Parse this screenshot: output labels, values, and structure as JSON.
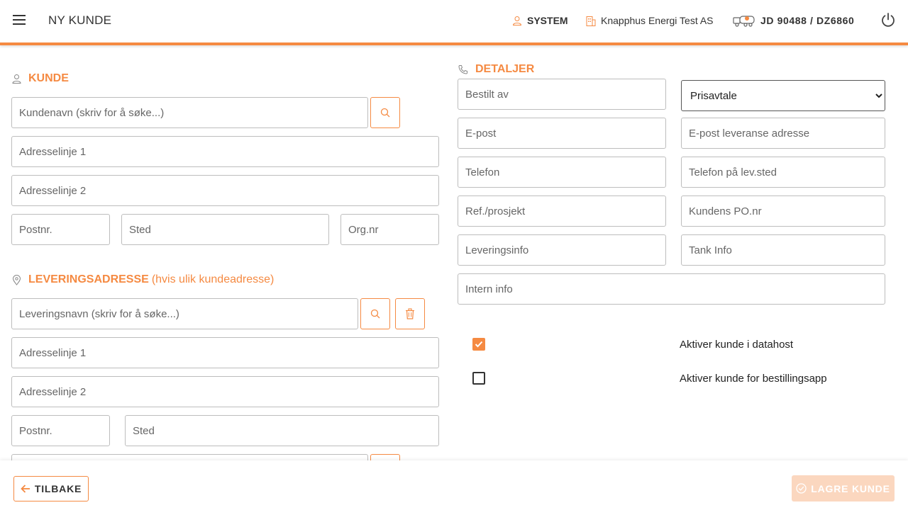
{
  "header": {
    "title": "NY KUNDE",
    "user": "SYSTEM",
    "company": "Knapphus Energi Test AS",
    "vehicle": "JD 90488 / DZ6860",
    "icons": {
      "menu": "hamburger-menu-icon",
      "user": "user-icon",
      "company": "building-icon",
      "vehicle": "truck-icon",
      "power": "power-icon"
    }
  },
  "kunde": {
    "heading": "KUNDE",
    "name_placeholder": "Kundenavn (skriv for å søke...)",
    "address1_placeholder": "Adresselinje 1",
    "address2_placeholder": "Adresselinje 2",
    "postnr_placeholder": "Postnr.",
    "sted_placeholder": "Sted",
    "orgnr_placeholder": "Org.nr"
  },
  "levering": {
    "heading": "LEVERINGSADRESSE",
    "heading_suffix": "(hvis ulik kundeadresse)",
    "name_placeholder": "Leveringsnavn (skriv for å søke...)",
    "address1_placeholder": "Adresselinje 1",
    "address2_placeholder": "Adresselinje 2",
    "postnr_placeholder": "Postnr.",
    "sted_placeholder": "Sted"
  },
  "detaljer": {
    "heading": "DETALJER",
    "bestilt_av_placeholder": "Bestilt av",
    "prisavtale_selected": "Prisavtale",
    "epost_placeholder": "E-post",
    "epost_leveranse_placeholder": "E-post leveranse adresse",
    "telefon_placeholder": "Telefon",
    "telefon_levsted_placeholder": "Telefon på lev.sted",
    "ref_placeholder": "Ref./prosjekt",
    "po_placeholder": "Kundens PO.nr",
    "leveringsinfo_placeholder": "Leveringsinfo",
    "tankinfo_placeholder": "Tank Info",
    "intern_placeholder": "Intern info"
  },
  "checkboxes": [
    {
      "label": "Aktiver kunde i datahost",
      "checked": true
    },
    {
      "label": "Aktiver kunde for bestillingsapp",
      "checked": false
    }
  ],
  "footer": {
    "back_label": "TILBAKE",
    "save_label": "LAGRE KUNDE"
  },
  "colors": {
    "accent": "#f58a42",
    "save_disabled": "#fbd7bf"
  }
}
